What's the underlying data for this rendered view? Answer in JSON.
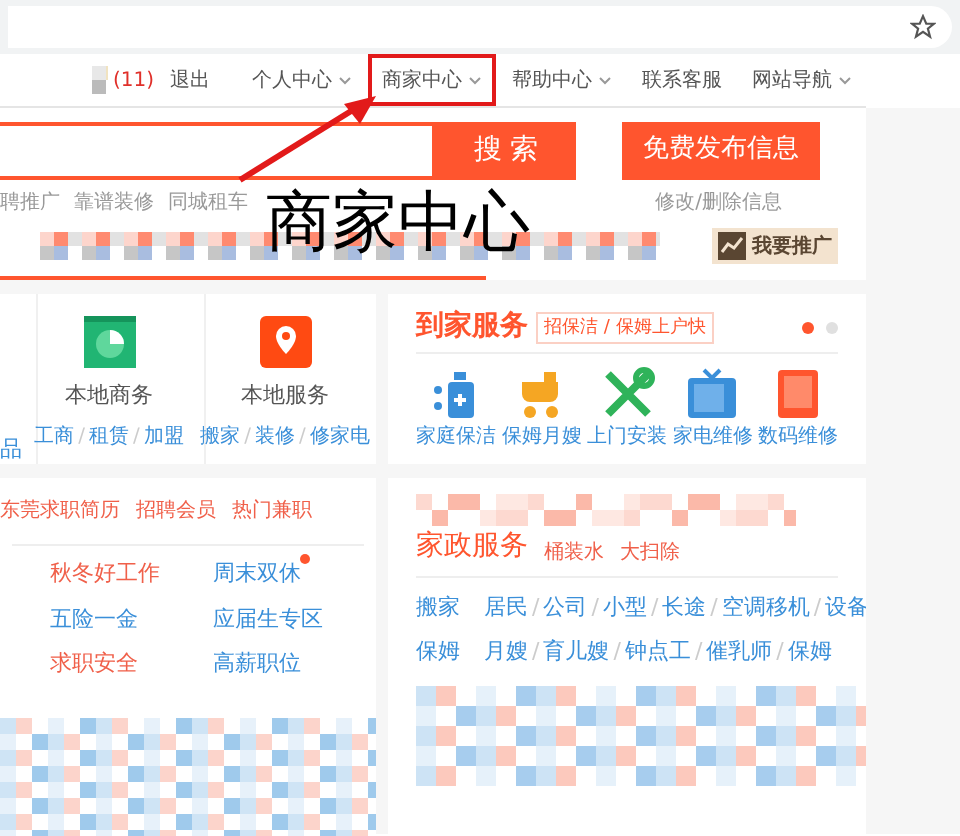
{
  "user_bar": {
    "message_count": "(11)",
    "logout": "退出",
    "menu": [
      {
        "label": "个人中心",
        "dropdown": true,
        "highlighted": false
      },
      {
        "label": "商家中心",
        "dropdown": true,
        "highlighted": true
      },
      {
        "label": "帮助中心",
        "dropdown": true,
        "highlighted": false
      },
      {
        "label": "联系客服",
        "dropdown": false,
        "highlighted": false
      },
      {
        "label": "网站导航",
        "dropdown": true,
        "highlighted": false
      }
    ]
  },
  "search": {
    "button": "搜 索",
    "post_button": "免费发布信息"
  },
  "hot_links": [
    "聘推广",
    "靠谱装修",
    "同城租车"
  ],
  "edit_link": "修改/删除信息",
  "annotation": {
    "text": "商家中心"
  },
  "promote_button": "我要推广",
  "separator": "/",
  "local_cards": {
    "partial_text": "品",
    "cards": [
      {
        "title": "本地商务",
        "kind": "chart",
        "links": [
          "工商",
          "租赁",
          "加盟"
        ]
      },
      {
        "title": "本地服务",
        "kind": "pin",
        "links": [
          "搬家",
          "装修",
          "修家电"
        ]
      }
    ]
  },
  "home_service": {
    "title": "到家服务",
    "tag": "招保洁 / 保姆上户快",
    "pages": [
      {
        "selected": true
      },
      {
        "selected": false
      }
    ],
    "items": [
      {
        "label": "家庭保洁",
        "kind": "bottle"
      },
      {
        "label": "保姆月嫂",
        "kind": "stroller"
      },
      {
        "label": "上门安装",
        "kind": "tools"
      },
      {
        "label": "家电维修",
        "kind": "tv"
      },
      {
        "label": "数码维修",
        "kind": "tablet"
      }
    ]
  },
  "jobs": {
    "links": [
      "东莞求职简历",
      "招聘会员",
      "热门兼职"
    ],
    "grid": [
      {
        "label": "秋冬好工作",
        "color": "#f0604a",
        "dot": false
      },
      {
        "label": "周末双休",
        "color": "#3a8fd9",
        "dot": true
      },
      {
        "label": "五险一金",
        "color": "#3a8fd9",
        "dot": false
      },
      {
        "label": "应届生专区",
        "color": "#3a8fd9",
        "dot": false
      },
      {
        "label": "求职安全",
        "color": "#f0604a",
        "dot": false
      },
      {
        "label": "高薪职位",
        "color": "#3a8fd9",
        "dot": false
      }
    ]
  },
  "housekeeping": {
    "title": "家政服务",
    "tags": [
      "桶装水",
      "大扫除"
    ],
    "rows": [
      {
        "category": "搬家",
        "links": [
          "居民",
          "公司",
          "小型",
          "长途",
          "空调移机",
          "设备"
        ]
      },
      {
        "category": "保姆",
        "links": [
          "月嫂",
          "育儿嫂",
          "钟点工",
          "催乳师",
          "保姆"
        ]
      }
    ]
  }
}
